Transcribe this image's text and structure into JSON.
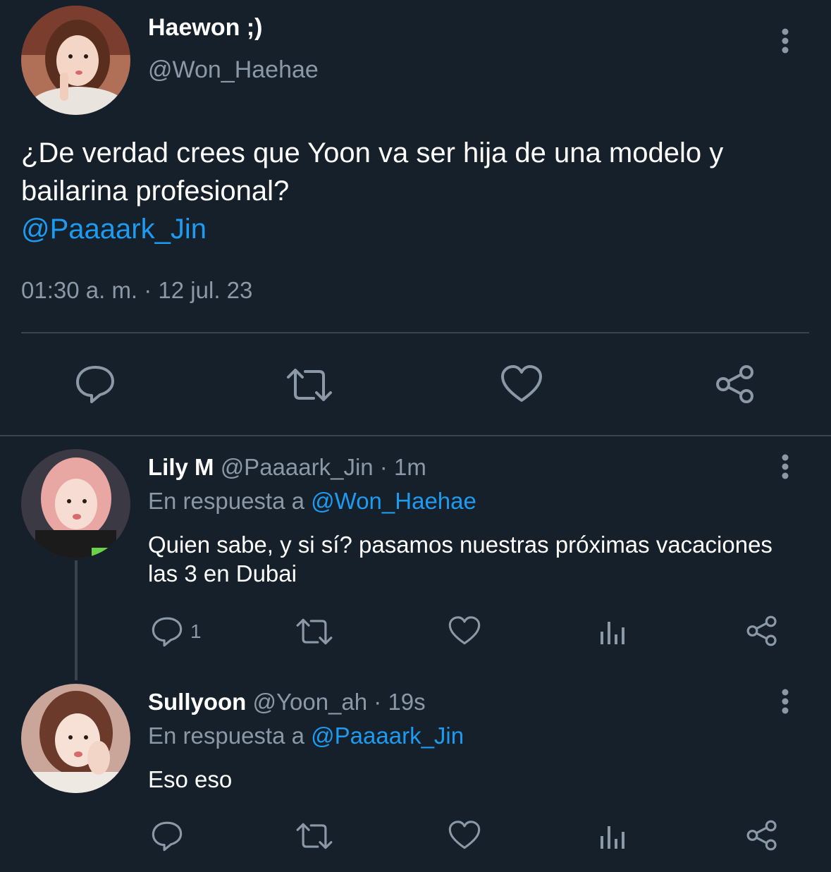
{
  "main_tweet": {
    "name": "Haewon ;)",
    "handle": "@Won_Haehae",
    "text": "¿De verdad crees que Yoon va ser hija de una modelo y bailarina profesional?",
    "mention": "@Paaaark_Jin",
    "timestamp": "01:30 a. m. · 12 jul. 23",
    "actions": [
      "reply-icon",
      "retweet-icon",
      "like-icon",
      "share-icon"
    ]
  },
  "replies": [
    {
      "name": "Lily M",
      "handle": "@Paaaark_Jin · 1m",
      "reply_to_prefix": "En respuesta a",
      "reply_to": "@Won_Haehae",
      "text": "Quien sabe, y si sí? pasamos nuestras próximas vacaciones las 3 en Dubai",
      "reply_count": "1"
    },
    {
      "name": "Sullyoon",
      "handle": "@Yoon_ah · 19s",
      "reply_to_prefix": "En respuesta a",
      "reply_to": "@Paaaark_Jin",
      "text": "Eso eso",
      "reply_count": ""
    }
  ],
  "colors": {
    "background": "#15202b",
    "muted": "#8b98a5",
    "link": "#1d9bf0",
    "divider": "#38444d"
  }
}
